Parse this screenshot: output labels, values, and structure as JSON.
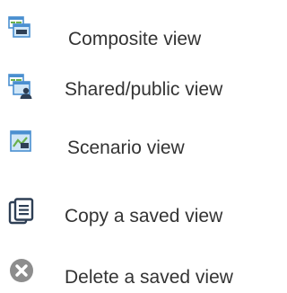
{
  "legend": {
    "items": [
      {
        "icon": "composite-view-icon",
        "label": "Composite view"
      },
      {
        "icon": "shared-public-view-icon",
        "label": "Shared/public view"
      },
      {
        "icon": "scenario-view-icon",
        "label": "Scenario view"
      },
      {
        "icon": "copy-saved-view-icon",
        "label": "Copy a saved view"
      },
      {
        "icon": "delete-saved-view-icon",
        "label": "Delete a saved view"
      }
    ]
  },
  "colors": {
    "text": "#333333",
    "icon_blue": "#4a8fd0",
    "icon_light_blue": "#cfe6f7",
    "icon_green": "#6ab04c",
    "icon_dark": "#2e3f55",
    "icon_gray": "#8d8d8d"
  }
}
